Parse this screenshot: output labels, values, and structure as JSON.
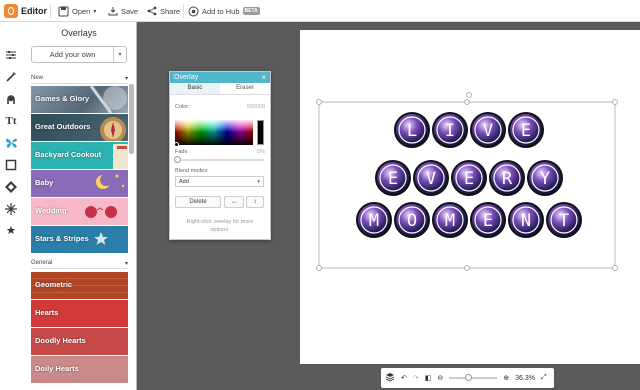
{
  "topbar": {
    "app_name": "Editor",
    "open_label": "Open",
    "save_label": "Save",
    "share_label": "Share",
    "hub_label": "Add to Hub",
    "hub_badge": "BETA"
  },
  "panel": {
    "title": "Overlays",
    "add_own_label": "Add your own",
    "sections": [
      {
        "label": "New",
        "items": [
          "Games & Glory",
          "Great Outdoors",
          "Backyard Cookout",
          "Baby",
          "Wedding",
          "Stars & Stripes"
        ]
      },
      {
        "label": "General",
        "items": [
          "Geometric",
          "Hearts",
          "Doodly Hearts",
          "Doily Hearts"
        ]
      }
    ]
  },
  "dialog": {
    "title": "Overlay",
    "tabs": [
      "Basic",
      "Eraser"
    ],
    "color_label": "Color:",
    "color_value": "000000",
    "fade_label": "Fade",
    "fade_value": "0%",
    "blend_label": "Blend modes:",
    "blend_value": "Add",
    "delete_label": "Delete",
    "hint": "Right-click overlay for more options."
  },
  "canvas": {
    "rows": [
      [
        "L",
        "I",
        "V",
        "E"
      ],
      [
        "E",
        "V",
        "E",
        "R",
        "Y"
      ],
      [
        "M",
        "O",
        "M",
        "E",
        "N",
        "T"
      ]
    ]
  },
  "bottombar": {
    "zoom": "36.3%"
  },
  "colors": {
    "accent": "#4fb7c9",
    "thumbs": [
      "#6b7f8f",
      "#3e5b6b",
      "#2bb3b2",
      "#8a6bb8",
      "#f09cb1",
      "#2a7ea8",
      "#c2502e",
      "#d23a3a",
      "#c84b4b",
      "#cb8a8a"
    ]
  }
}
